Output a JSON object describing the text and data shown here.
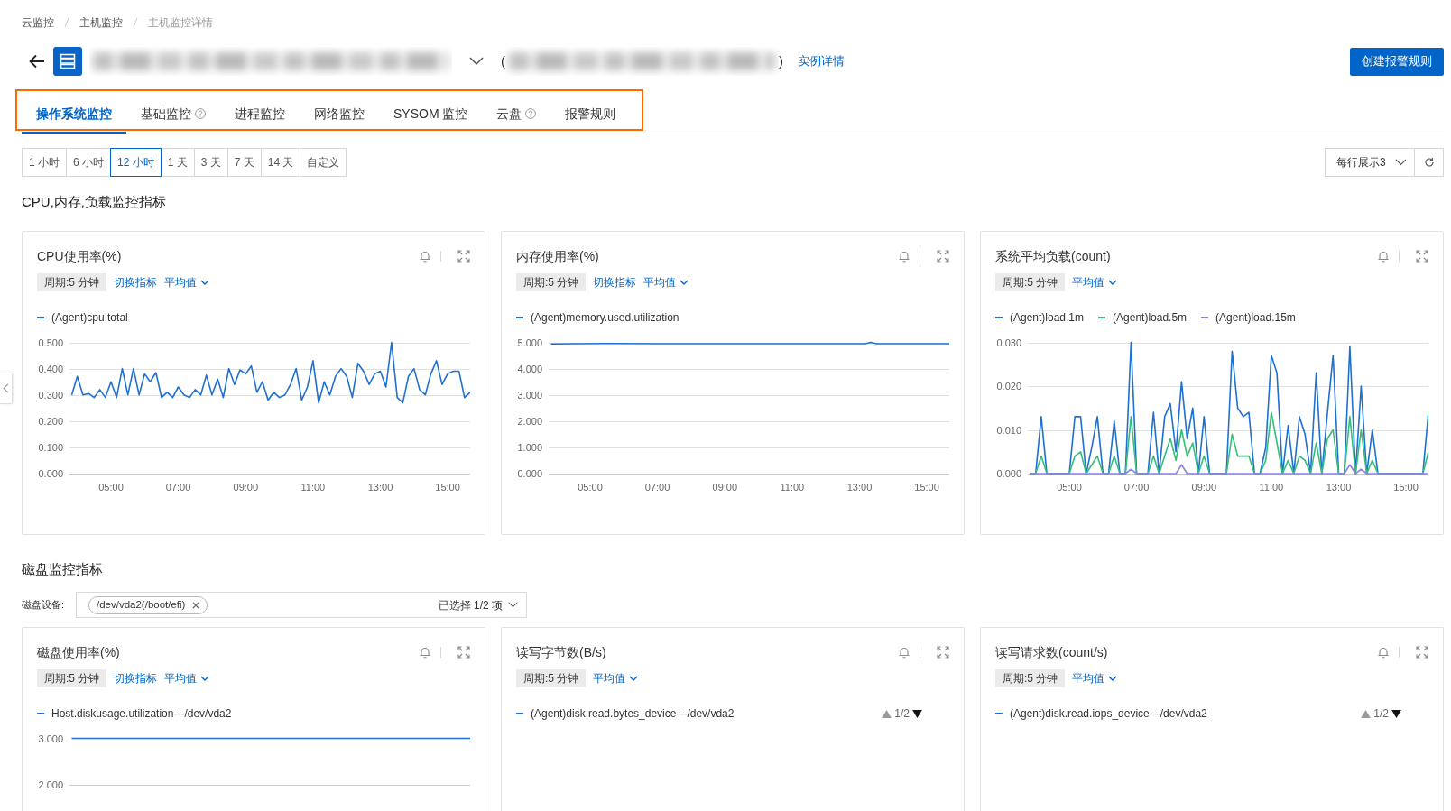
{
  "breadcrumb": [
    {
      "label": "云监控",
      "current": false
    },
    {
      "label": "主机监控",
      "current": false
    },
    {
      "label": "主机监控详情",
      "current": true
    }
  ],
  "header": {
    "id_open": "(",
    "id_close": ")",
    "detail_link": "实例详情",
    "create_button": "创建报警规则"
  },
  "tab_bar": {
    "highlighted": true,
    "tabs": [
      {
        "label": "操作系统监控",
        "selected": true,
        "help": false
      },
      {
        "label": "基础监控",
        "selected": false,
        "help": true
      },
      {
        "label": "进程监控",
        "selected": false,
        "help": false
      },
      {
        "label": "网络监控",
        "selected": false,
        "help": false
      },
      {
        "label": "SYSOM 监控",
        "selected": false,
        "help": false
      },
      {
        "label": "云盘",
        "selected": false,
        "help": true
      },
      {
        "label": "报警规则",
        "selected": false,
        "help": false
      }
    ]
  },
  "time_ranges": [
    {
      "label": "1 小时",
      "selected": false
    },
    {
      "label": "6 小时",
      "selected": false
    },
    {
      "label": "12 小时",
      "selected": true
    },
    {
      "label": "1 天",
      "selected": false
    },
    {
      "label": "3 天",
      "selected": false
    },
    {
      "label": "7 天",
      "selected": false
    },
    {
      "label": "14 天",
      "selected": false
    },
    {
      "label": "自定义",
      "selected": false
    }
  ],
  "layout_select": {
    "value": "每行展示3"
  },
  "sections": [
    {
      "title": "CPU,内存,负载监控指标",
      "cards": [
        {
          "title": "CPU使用率(%)",
          "period": "周期:5 分钟",
          "switch_link": "切换指标",
          "aggregate": "平均值",
          "chart_data": {
            "type": "line",
            "grid": true,
            "x": [
              230,
              240,
              250,
              260,
              270,
              280,
              290,
              300,
              310,
              320,
              330,
              340,
              350,
              360,
              370,
              380,
              390,
              400,
              410,
              420,
              430,
              440,
              450,
              460,
              470,
              480,
              490,
              500,
              510,
              520,
              530,
              540,
              550,
              560,
              570,
              580,
              590,
              600,
              610,
              620,
              630,
              640,
              650,
              660,
              670,
              680,
              690,
              700,
              710,
              720,
              730,
              740,
              750,
              760,
              770,
              780,
              790,
              800,
              810,
              820,
              830,
              840,
              850,
              860,
              870,
              880,
              890,
              900,
              910,
              920,
              930,
              940
            ],
            "xlim": [
              226,
              940
            ],
            "ylim": [
              0,
              0.5
            ],
            "xticks": [
              {
                "value": 300,
                "label": "05:00"
              },
              {
                "value": 420,
                "label": "07:00"
              },
              {
                "value": 540,
                "label": "09:00"
              },
              {
                "value": 660,
                "label": "11:00"
              },
              {
                "value": 780,
                "label": "13:00"
              },
              {
                "value": 900,
                "label": "15:00"
              }
            ],
            "yticks": [
              {
                "value": 0,
                "label": "0.000"
              },
              {
                "value": 0.1,
                "label": "0.100"
              },
              {
                "value": 0.2,
                "label": "0.200"
              },
              {
                "value": 0.3,
                "label": "0.300"
              },
              {
                "value": 0.4,
                "label": "0.400"
              },
              {
                "value": 0.5,
                "label": "0.500"
              }
            ],
            "series": [
              {
                "name": "(Agent)cpu.total",
                "color": "#1f70d0",
                "values": [
                  0.3,
                  0.37,
                  0.3,
                  0.305,
                  0.29,
                  0.32,
                  0.29,
                  0.35,
                  0.29,
                  0.4,
                  0.3,
                  0.4,
                  0.3,
                  0.38,
                  0.35,
                  0.385,
                  0.29,
                  0.31,
                  0.29,
                  0.33,
                  0.3,
                  0.29,
                  0.32,
                  0.3,
                  0.375,
                  0.3,
                  0.36,
                  0.29,
                  0.4,
                  0.34,
                  0.395,
                  0.38,
                  0.41,
                  0.31,
                  0.35,
                  0.28,
                  0.31,
                  0.29,
                  0.3,
                  0.34,
                  0.4,
                  0.28,
                  0.33,
                  0.43,
                  0.27,
                  0.35,
                  0.3,
                  0.37,
                  0.4,
                  0.37,
                  0.29,
                  0.42,
                  0.39,
                  0.34,
                  0.38,
                  0.39,
                  0.33,
                  0.5,
                  0.29,
                  0.27,
                  0.37,
                  0.4,
                  0.32,
                  0.3,
                  0.38,
                  0.43,
                  0.34,
                  0.38,
                  0.39,
                  0.39,
                  0.29,
                  0.31
                ]
              }
            ]
          }
        },
        {
          "title": "内存使用率(%)",
          "period": "周期:5 分钟",
          "switch_link": "切换指标",
          "aggregate": "平均值",
          "chart_data": {
            "type": "line",
            "grid": true,
            "x": [
              230,
              330,
              430,
              530,
              630,
              730,
              790,
              800,
              810,
              940
            ],
            "xlim": [
              226,
              940
            ],
            "ylim": [
              0,
              5
            ],
            "xticks": [
              {
                "value": 300,
                "label": "05:00"
              },
              {
                "value": 420,
                "label": "07:00"
              },
              {
                "value": 540,
                "label": "09:00"
              },
              {
                "value": 660,
                "label": "11:00"
              },
              {
                "value": 780,
                "label": "13:00"
              },
              {
                "value": 900,
                "label": "15:00"
              }
            ],
            "yticks": [
              {
                "value": 0,
                "label": "0.000"
              },
              {
                "value": 1,
                "label": "1.000"
              },
              {
                "value": 2,
                "label": "2.000"
              },
              {
                "value": 3,
                "label": "3.000"
              },
              {
                "value": 4,
                "label": "4.000"
              },
              {
                "value": 5,
                "label": "5.000"
              }
            ],
            "series": [
              {
                "name": "(Agent)memory.used.utilization",
                "color": "#1f70d0",
                "values": [
                  4.94,
                  4.96,
                  4.95,
                  4.95,
                  4.95,
                  4.95,
                  4.95,
                  5.0,
                  4.95,
                  4.95
                ]
              }
            ]
          }
        },
        {
          "title": "系统平均负载(count)",
          "period": "周期:5 分钟",
          "aggregate": "平均值",
          "chart_data": {
            "type": "line",
            "grid": true,
            "x": [
              230,
              240,
              250,
              260,
              270,
              280,
              290,
              300,
              310,
              320,
              330,
              340,
              350,
              360,
              370,
              380,
              390,
              400,
              410,
              420,
              430,
              440,
              450,
              460,
              470,
              480,
              490,
              500,
              510,
              520,
              530,
              540,
              550,
              560,
              570,
              580,
              590,
              600,
              610,
              620,
              630,
              640,
              650,
              660,
              670,
              680,
              690,
              700,
              710,
              720,
              730,
              740,
              750,
              760,
              770,
              780,
              790,
              800,
              810,
              820,
              830,
              840,
              850,
              860,
              870,
              880,
              890,
              900,
              910,
              920,
              930,
              940
            ],
            "xlim": [
              226,
              940
            ],
            "ylim": [
              0,
              0.03
            ],
            "xticks": [
              {
                "value": 300,
                "label": "05:00"
              },
              {
                "value": 420,
                "label": "07:00"
              },
              {
                "value": 540,
                "label": "09:00"
              },
              {
                "value": 660,
                "label": "11:00"
              },
              {
                "value": 780,
                "label": "13:00"
              },
              {
                "value": 900,
                "label": "15:00"
              }
            ],
            "yticks": [
              {
                "value": 0,
                "label": "0.000"
              },
              {
                "value": 0.01,
                "label": "0.010"
              },
              {
                "value": 0.02,
                "label": "0.020"
              },
              {
                "value": 0.03,
                "label": "0.030"
              }
            ],
            "series": [
              {
                "name": "(Agent)load.1m",
                "color": "#1f70d0",
                "values": [
                  0,
                  0,
                  0.013,
                  0,
                  0,
                  0,
                  0,
                  0,
                  0.013,
                  0.013,
                  0,
                  0.006,
                  0.013,
                  0,
                  0,
                  0.012,
                  0,
                  0,
                  0.03,
                  0,
                  0,
                  0,
                  0.014,
                  0,
                  0.013,
                  0.016,
                  0.005,
                  0.021,
                  0.008,
                  0.015,
                  0,
                  0.013,
                  0,
                  0,
                  0,
                  0,
                  0.028,
                  0.015,
                  0.013,
                  0.014,
                  0,
                  0,
                  0.006,
                  0.027,
                  0.023,
                  0,
                  0.011,
                  0,
                  0.013,
                  0.009,
                  0,
                  0.023,
                  0,
                  0.014,
                  0.027,
                  0,
                  0,
                  0.029,
                  0,
                  0.02,
                  0,
                  0.01,
                  0,
                  0,
                  0,
                  0,
                  0,
                  0,
                  0,
                  0,
                  0,
                  0.014
                ]
              },
              {
                "name": "(Agent)load.5m",
                "color": "#36bf78",
                "values": [
                  0,
                  0,
                  0.004,
                  0,
                  0,
                  0,
                  0,
                  0,
                  0.004,
                  0.005,
                  0,
                  0.002,
                  0.004,
                  0,
                  0,
                  0.004,
                  0,
                  0,
                  0.013,
                  0,
                  0,
                  0,
                  0.004,
                  0,
                  0.004,
                  0.008,
                  0.003,
                  0.01,
                  0.004,
                  0.007,
                  0,
                  0.004,
                  0,
                  0,
                  0,
                  0,
                  0.009,
                  0.004,
                  0.004,
                  0.004,
                  0,
                  0,
                  0.003,
                  0.014,
                  0.007,
                  0,
                  0.003,
                  0,
                  0.004,
                  0.003,
                  0,
                  0.007,
                  0,
                  0.008,
                  0.01,
                  0,
                  0,
                  0.013,
                  0,
                  0.01,
                  0,
                  0.003,
                  0,
                  0,
                  0,
                  0,
                  0,
                  0,
                  0,
                  0,
                  0,
                  0.005
                ]
              },
              {
                "name": "(Agent)load.15m",
                "color": "#8b83e8",
                "values": [
                  0,
                  0,
                  0,
                  0,
                  0,
                  0,
                  0,
                  0,
                  0,
                  0,
                  0,
                  0,
                  0,
                  0,
                  0,
                  0,
                  0,
                  0,
                  0.001,
                  0,
                  0,
                  0,
                  0,
                  0,
                  0,
                  0,
                  0,
                  0.002,
                  0,
                  0,
                  0,
                  0,
                  0,
                  0,
                  0,
                  0,
                  0,
                  0,
                  0,
                  0,
                  0,
                  0,
                  0,
                  0,
                  0,
                  0,
                  0,
                  0,
                  0,
                  0,
                  0,
                  0,
                  0,
                  0,
                  0,
                  0,
                  0,
                  0.002,
                  0,
                  0.001,
                  0,
                  0,
                  0,
                  0,
                  0,
                  0,
                  0,
                  0,
                  0,
                  0,
                  0,
                  0
                ]
              }
            ]
          }
        }
      ]
    },
    {
      "title": "磁盘监控指标",
      "device_filter": {
        "label": "磁盘设备:",
        "tags": [
          "/dev/vda2(/boot/efi)"
        ],
        "summary": "已选择 1/2 项"
      },
      "cards": [
        {
          "title": "磁盘使用率(%)",
          "period": "周期:5 分钟",
          "switch_link": "切换指标",
          "aggregate": "平均值",
          "chart_data": {
            "type": "line",
            "x": [
              230,
              940
            ],
            "xlim": [
              226,
              940
            ],
            "ylim": [
              2,
              3
            ],
            "yticks": [
              {
                "value": 2,
                "label": "2.000"
              },
              {
                "value": 3,
                "label": "3.000"
              }
            ],
            "series": [
              {
                "name": "Host.diskusage.utilization---/dev/vda2",
                "color": "#1f70d0",
                "values": [
                  3,
                  3
                ]
              }
            ]
          }
        },
        {
          "title": "读写字节数(B/s)",
          "period": "周期:5 分钟",
          "aggregate": "平均值",
          "legend": [
            {
              "name": "(Agent)disk.read.bytes_device---/dev/vda2",
              "color": "#1f70d0"
            }
          ],
          "pager": {
            "label": "1/2",
            "prev_disabled": true,
            "next_disabled": false
          }
        },
        {
          "title": "读写请求数(count/s)",
          "period": "周期:5 分钟",
          "aggregate": "平均值",
          "legend": [
            {
              "name": "(Agent)disk.read.iops_device---/dev/vda2",
              "color": "#1f70d0"
            }
          ],
          "pager": {
            "label": "1/2",
            "prev_disabled": true,
            "next_disabled": false
          }
        }
      ]
    }
  ]
}
